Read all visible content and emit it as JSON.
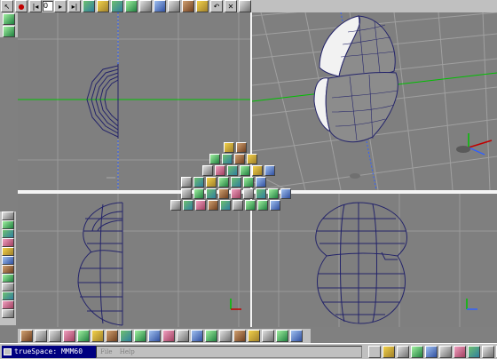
{
  "toolbar_top": {
    "frame_value": "0",
    "buttons": [
      {
        "name": "select-tool-icon",
        "glyph": "↖",
        "style": ""
      },
      {
        "name": "record-icon",
        "glyph": "●",
        "style": "red"
      },
      {
        "name": "rewind-icon",
        "glyph": "|◂",
        "style": ""
      },
      {
        "name": "play-icon",
        "glyph": "▸",
        "style": ""
      },
      {
        "name": "step-forward-icon",
        "glyph": "▸|",
        "style": ""
      },
      {
        "name": "object-tool-icon",
        "glyph": "",
        "style": "col"
      },
      {
        "name": "paint-tool-icon",
        "glyph": "",
        "style": "yel"
      },
      {
        "name": "move-tool-icon",
        "glyph": "",
        "style": "col"
      },
      {
        "name": "rotate-tool-icon",
        "glyph": "",
        "style": "green"
      },
      {
        "name": "scale-tool-icon",
        "glyph": "",
        "style": "grey"
      },
      {
        "name": "render-tool-icon",
        "glyph": "",
        "style": "blue"
      },
      {
        "name": "camera-tool-icon",
        "glyph": "",
        "style": "grey"
      },
      {
        "name": "link-tool-icon",
        "glyph": "",
        "style": "brown"
      },
      {
        "name": "light-tool-icon",
        "glyph": "",
        "style": "yel"
      },
      {
        "name": "undo-icon",
        "glyph": "↶",
        "style": ""
      },
      {
        "name": "delete-icon",
        "glyph": "✕",
        "style": ""
      },
      {
        "name": "view-tool-icon",
        "glyph": "",
        "style": "grey"
      }
    ]
  },
  "left_toolbar": [
    {
      "name": "workspace-icon",
      "style": "grey"
    },
    {
      "name": "primitives-icon",
      "style": "green"
    },
    {
      "name": "surface-icon",
      "style": "col"
    },
    {
      "name": "boolean-icon",
      "style": "pink"
    },
    {
      "name": "material-icon",
      "style": "yel"
    },
    {
      "name": "color-icon",
      "style": "blue"
    },
    {
      "name": "texture-icon",
      "style": "brown"
    },
    {
      "name": "modeling-icon",
      "style": "green"
    },
    {
      "name": "animation-icon",
      "style": "grey"
    },
    {
      "name": "deform-icon",
      "style": "col"
    },
    {
      "name": "render-options-icon",
      "style": "pink"
    },
    {
      "name": "nav-icon",
      "style": "grey"
    }
  ],
  "toolbar_bottom": [
    {
      "name": "sphere-icon",
      "style": "brown"
    },
    {
      "name": "plane-icon",
      "style": "grey"
    },
    {
      "name": "film-icon",
      "style": "grey"
    },
    {
      "name": "object-icon",
      "style": "pink"
    },
    {
      "name": "ball-icon",
      "style": "green"
    },
    {
      "name": "material-ball-icon",
      "style": "yel"
    },
    {
      "name": "wood-icon",
      "style": "brown"
    },
    {
      "name": "tube-icon",
      "style": "col"
    },
    {
      "name": "bend-icon",
      "style": "green"
    },
    {
      "name": "paint-icon",
      "style": "blue"
    },
    {
      "name": "texture-map-icon",
      "style": "pink"
    },
    {
      "name": "checker-icon",
      "style": "grey"
    },
    {
      "name": "layer-icon",
      "style": "blue"
    },
    {
      "name": "plugin-icon",
      "style": "green"
    },
    {
      "name": "axis-icon",
      "style": "grey"
    },
    {
      "name": "joint-icon",
      "style": "brown"
    },
    {
      "name": "face-icon",
      "style": "yel"
    },
    {
      "name": "camera-icon",
      "style": "grey"
    },
    {
      "name": "grass-icon",
      "style": "green"
    },
    {
      "name": "world-icon",
      "style": "blue"
    }
  ],
  "taskbar": {
    "app_label": "trueSpace: МММ60",
    "menu_items": [
      "File",
      "Help"
    ]
  },
  "tray_icons": [
    {
      "name": "tray-select-icon",
      "style": ""
    },
    {
      "name": "tray-person-icon",
      "style": "yel"
    },
    {
      "name": "tray-grid-icon",
      "style": "grey"
    },
    {
      "name": "tray-color-icon",
      "style": "green"
    },
    {
      "name": "tray-box-icon",
      "style": "blue"
    },
    {
      "name": "tray-arrow-icon",
      "style": "grey"
    },
    {
      "name": "tray-ball-icon",
      "style": "pink"
    },
    {
      "name": "tray-view-icon",
      "style": "col"
    },
    {
      "name": "tray-scroll-icon",
      "style": "grey"
    },
    {
      "name": "tray-render-icon",
      "style": "brown"
    },
    {
      "name": "tray-zoom-icon",
      "style": "grey"
    }
  ],
  "palette_popup_rows": [
    [
      "yel",
      "brown"
    ],
    [
      "green",
      "col",
      "brown",
      "yel"
    ],
    [
      "grey",
      "pink",
      "col",
      "green",
      "yel",
      "blue"
    ],
    [
      "grey",
      "col",
      "yel",
      "green",
      "col",
      "green",
      "blue"
    ],
    [
      "grey",
      "green",
      "col",
      "brown",
      "pink",
      "grey",
      "col",
      "green",
      "blue"
    ],
    [
      "grey",
      "col",
      "pink",
      "brown",
      "col",
      "grey",
      "green",
      "green",
      "blue"
    ]
  ],
  "colors": {
    "viewport_bg": "#7f7f7f",
    "grid": "#9a9a9a",
    "wire": "#24246a",
    "axis_green": "#00c000",
    "axis_blue": "#3060ff",
    "axis_red": "#c00000"
  }
}
